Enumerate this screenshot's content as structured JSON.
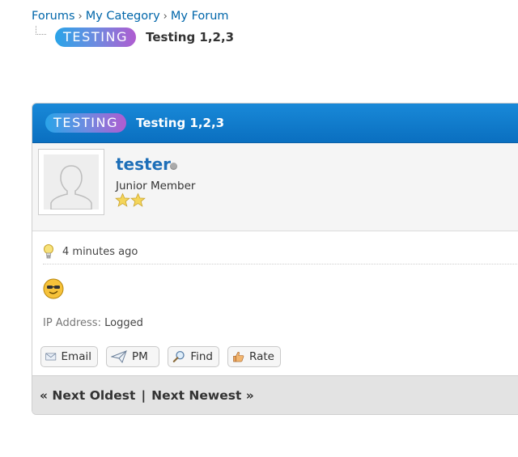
{
  "breadcrumb": {
    "items": [
      "Forums",
      "My Category",
      "My Forum"
    ],
    "separator": "›"
  },
  "thread": {
    "prefix": "TESTING",
    "title": "Testing 1,2,3"
  },
  "post": {
    "header_prefix": "TESTING",
    "header_title": "Testing 1,2,3",
    "author": {
      "username": "tester",
      "user_title": "Junior Member",
      "stars": 2,
      "online_status": "offline"
    },
    "date": "4 minutes ago",
    "ip_label": "IP Address:",
    "ip_value": "Logged",
    "buttons": {
      "email": "Email",
      "pm": "PM",
      "find": "Find",
      "rate": "Rate"
    }
  },
  "navigation": {
    "prev": "« Next Oldest",
    "separator": "|",
    "next": "Next Newest »"
  },
  "colors": {
    "header_blue": "#0a74c8",
    "link_blue": "#0066aa",
    "username_blue": "#1e6fb8"
  }
}
